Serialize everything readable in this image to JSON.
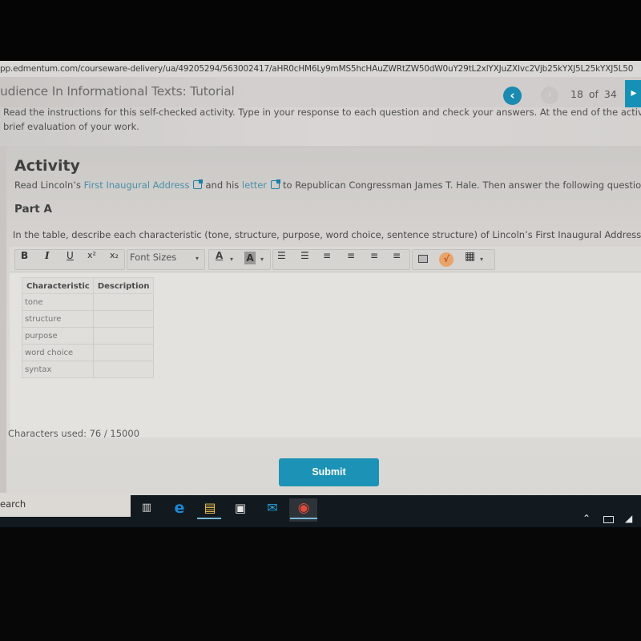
{
  "browser": {
    "url": "pp.edmentum.com/courseware-delivery/ua/49205294/563002417/aHR0cHM6Ly9mMS5hcHAuZWRtZW50dW0uY29tL2xlYXJuZXIvc2Vjb25kYXJ5L25kYXJ5L50"
  },
  "header": {
    "title": "udience In Informational Texts: Tutorial",
    "prev_icon": "chevron-left-icon",
    "next_icon": "chevron-right-icon",
    "page_current": "18",
    "page_of": "of",
    "page_total": "34",
    "page_counter": "18  of  34",
    "exit_icon": "exit-icon"
  },
  "instructions": {
    "line1": "Read the instructions for this self-checked activity. Type in your response to each question and check your answers. At the end of the activity, w",
    "line2": "brief evaluation of your work."
  },
  "activity": {
    "title": "Activity",
    "text_before": "Read Lincoln’s",
    "link1": "First Inaugural Address",
    "text_middle": "and his",
    "link2": "letter",
    "text_after": "to Republican Congressman James T. Hale. Then answer the following questions."
  },
  "part_a": {
    "title": "Part A",
    "prompt": "In the table, describe each characteristic (tone, structure, purpose, word choice, sentence structure) of Lincoln’s First Inaugural Address."
  },
  "toolbar": {
    "bold": "B",
    "italic": "I",
    "underline": "U",
    "superscript": "x²",
    "subscript": "x₂",
    "font_sizes": "Font Sizes",
    "font_color": "A",
    "highlight_color": "A",
    "icons": [
      "bold-icon",
      "italic-icon",
      "underline-icon",
      "superscript-icon",
      "subscript-icon",
      "font-color-icon",
      "highlight-icon",
      "bullet-list-icon",
      "numbered-list-icon",
      "indent-icon",
      "align-left-icon",
      "align-center-icon",
      "align-right-icon",
      "image-icon",
      "math-icon",
      "table-icon"
    ]
  },
  "table": {
    "headers": [
      "Characteristic",
      "Description"
    ],
    "rows": [
      {
        "characteristic": "tone",
        "description": ""
      },
      {
        "characteristic": "structure",
        "description": ""
      },
      {
        "characteristic": "purpose",
        "description": ""
      },
      {
        "characteristic": "word choice",
        "description": ""
      },
      {
        "characteristic": "syntax",
        "description": ""
      }
    ]
  },
  "char_count": {
    "label": "Characters used: 76 / 15000",
    "used": 76,
    "max": 15000
  },
  "submit_label": "Submit",
  "taskbar": {
    "search_text": "earch",
    "apps": [
      "task-view",
      "edge",
      "file-explorer",
      "store",
      "mail",
      "chrome"
    ]
  },
  "colors": {
    "accent": "#1c93b6",
    "link": "#4a8fa8",
    "taskbar": "#121a20"
  }
}
